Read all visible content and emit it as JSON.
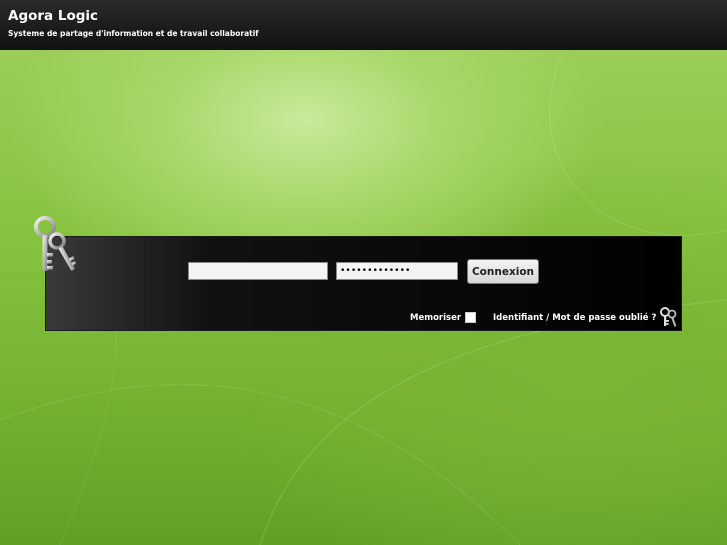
{
  "header": {
    "title": "Agora Logic",
    "subtitle": "Systeme de partage d'information et de travail collaboratif"
  },
  "login": {
    "username_value": "",
    "password_value": "•••••••••••••",
    "submit_label": "Connexion",
    "remember_label": "Memoriser",
    "remember_checked": false,
    "forgot_label": "Identifiant / Mot de passe oublié ?"
  },
  "icons": {
    "login_panel_icon": "keys-icon",
    "forgot_icon": "keys-icon"
  },
  "colors": {
    "header_bg": "#111111",
    "panel_bg": "#000000",
    "background_green": "#86c23e",
    "text_light": "#ffffff"
  }
}
